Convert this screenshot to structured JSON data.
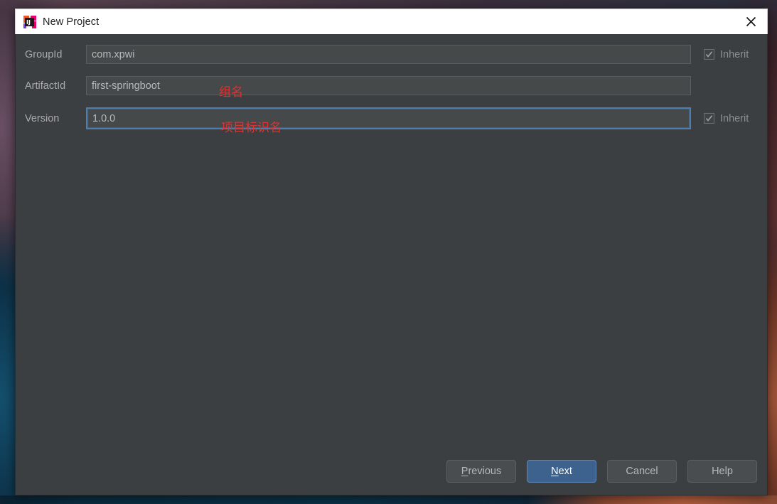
{
  "window": {
    "title": "New Project",
    "icon": "intellij-idea-icon",
    "close_icon": "close-icon",
    "titlebar_bg": "#ffffff",
    "body_bg": "#3c3f41"
  },
  "form": {
    "rows": [
      {
        "label": "GroupId",
        "value": "com.xpwi",
        "placeholder": "",
        "focused": false,
        "inherit": {
          "label": "Inherit",
          "checked": true,
          "enabled": false,
          "visible": true
        }
      },
      {
        "label": "ArtifactId",
        "value": "first-springboot",
        "placeholder": "",
        "focused": false,
        "inherit": {
          "label": "",
          "checked": false,
          "enabled": false,
          "visible": false
        }
      },
      {
        "label": "Version",
        "value": "1.0.0",
        "placeholder": "",
        "focused": true,
        "inherit": {
          "label": "Inherit",
          "checked": true,
          "enabled": false,
          "visible": true
        }
      }
    ]
  },
  "annotations": [
    {
      "text": "组名",
      "color": "#e03131",
      "target": "GroupId"
    },
    {
      "text": "项目标识名",
      "color": "#e03131",
      "target": "ArtifactId"
    }
  ],
  "buttons": {
    "previous": {
      "label": "Previous",
      "mnemonic": "P",
      "primary": false
    },
    "next": {
      "label": "Next",
      "mnemonic": "N",
      "primary": true
    },
    "cancel": {
      "label": "Cancel",
      "mnemonic": "",
      "primary": false
    },
    "help": {
      "label": "Help",
      "mnemonic": "",
      "primary": false
    }
  },
  "colors": {
    "accent": "#3c628d",
    "focus_border": "#4b7fb3",
    "annotation_red": "#e03131",
    "field_bg": "#45494a"
  }
}
